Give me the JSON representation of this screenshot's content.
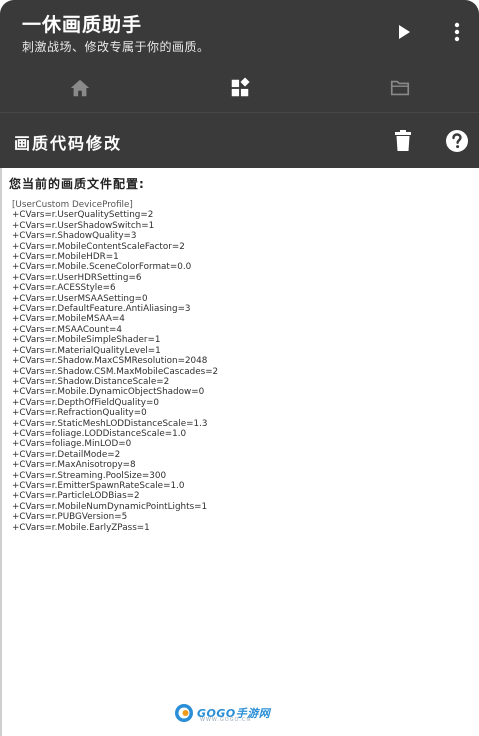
{
  "app": {
    "title": "一休画质助手",
    "subtitle": "刺激战场、修改专属于你的画质。"
  },
  "navbar": {
    "tabs": [
      {
        "icon": "home-icon",
        "active": false
      },
      {
        "icon": "dashboard-icon",
        "active": true
      },
      {
        "icon": "folder-icon",
        "active": false
      }
    ]
  },
  "toolbar": {
    "title": "画质代码修改"
  },
  "content": {
    "heading": "您当前的画质文件配置:",
    "config_lines": [
      "[UserCustom DeviceProfile]",
      "+CVars=r.UserQualitySetting=2",
      "+CVars=r.UserShadowSwitch=1",
      "+CVars=r.ShadowQuality=3",
      "+CVars=r.MobileContentScaleFactor=2",
      "+CVars=r.MobileHDR=1",
      "+CVars=r.Mobile.SceneColorFormat=0.0",
      "+CVars=r.UserHDRSetting=6",
      "+CVars=r.ACESStyle=6",
      "+CVars=r.UserMSAASetting=0",
      "+CVars=r.DefaultFeature.AntiAliasing=3",
      "+CVars=r.MobileMSAA=4",
      "+CVars=r.MSAACount=4",
      "+CVars=r.MobileSimpleShader=1",
      "+CVars=r.MaterialQualityLevel=1",
      "+CVars=r.Shadow.MaxCSMResolution=2048",
      "+CVars=r.Shadow.CSM.MaxMobileCascades=2",
      "+CVars=r.Shadow.DistanceScale=2",
      "+CVars=r.Mobile.DynamicObjectShadow=0",
      "+CVars=r.DepthOfFieldQuality=0",
      "+CVars=r.RefractionQuality=0",
      "+CVars=r.StaticMeshLODDistanceScale=1.3",
      "+CVars=foliage.LODDistanceScale=1.0",
      "+CVars=foliage.MinLOD=0",
      "+CVars=r.DetailMode=2",
      "+CVars=r.MaxAnisotropy=8",
      "+CVars=r.Streaming.PoolSize=300",
      "+CVars=r.EmitterSpawnRateScale=1.0",
      "+CVars=r.ParticleLODBias=2",
      "+CVars=r.MobileNumDynamicPointLights=1",
      "+CVars=r.PUBGVersion=5",
      "+CVars=r.Mobile.EarlyZPass=1"
    ]
  },
  "watermark": {
    "text": "GOGO手游网",
    "sub": "WWW.GOGO.CN"
  },
  "colors": {
    "appbar": "#3a3a3a",
    "text_light": "#ffffff",
    "icon_inactive": "#8a8a8a",
    "watermark": "#2a8fd6"
  }
}
